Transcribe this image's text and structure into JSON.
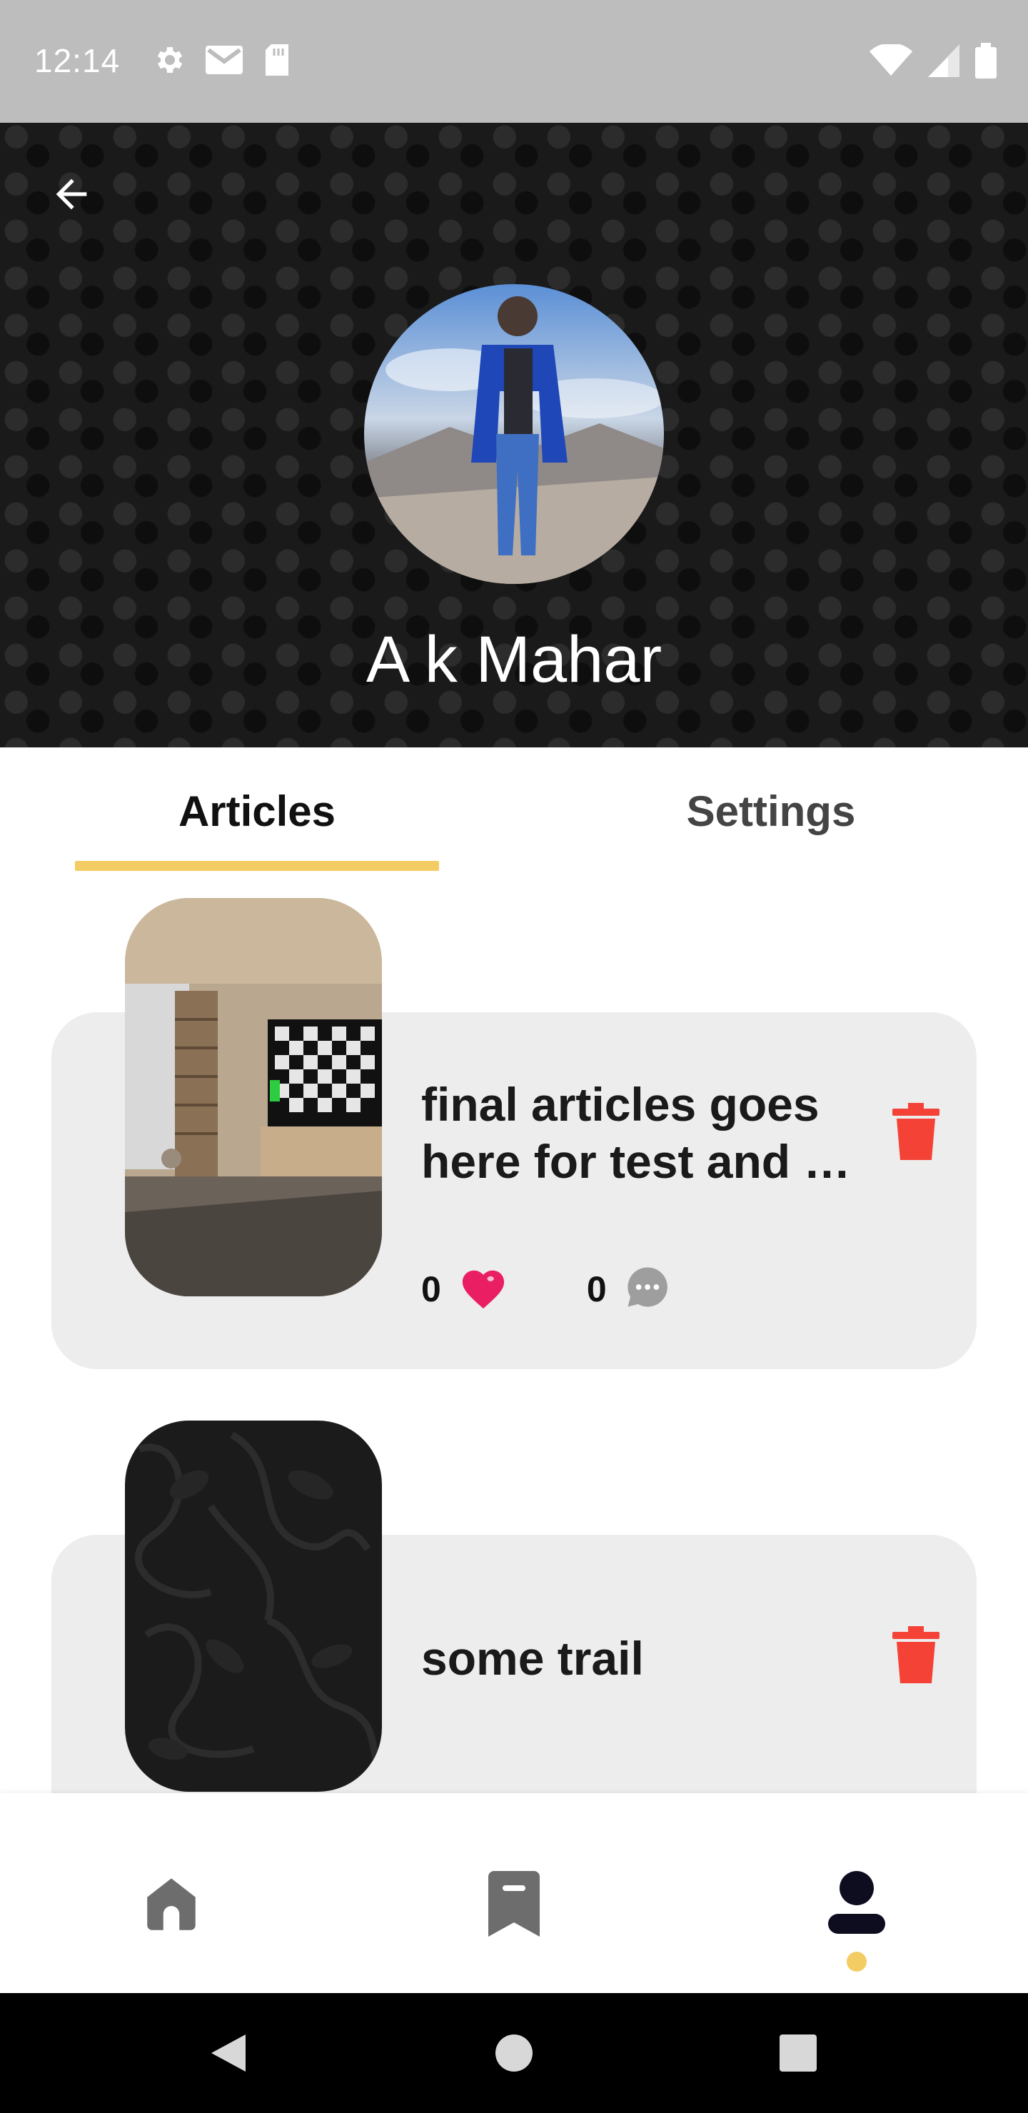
{
  "status_bar": {
    "time": "12:14",
    "left_icons": [
      "settings-icon",
      "gmail-icon",
      "sd-card-icon"
    ],
    "right_icons": [
      "wifi-icon",
      "signal-icon",
      "battery-icon"
    ]
  },
  "header": {
    "name": "A k Mahar",
    "avatar": "profile photo: person in blue jacket on mountain"
  },
  "tabs": [
    {
      "label": "Articles",
      "active": true
    },
    {
      "label": "Settings",
      "active": false
    }
  ],
  "articles": [
    {
      "title": "final articles goes here for test and …",
      "likes": "0",
      "comments": "0",
      "thumbnail": "room with tv"
    },
    {
      "title": "some trail",
      "thumbnail": "dark floral pattern"
    }
  ],
  "bottom_nav": {
    "items": [
      "home-icon",
      "bookmark-icon",
      "profile-icon"
    ],
    "active": "profile-icon"
  },
  "colors": {
    "accent": "#f3cc63",
    "delete": "#f44336",
    "heart": "#e91e63",
    "card_bg": "#ededed"
  }
}
